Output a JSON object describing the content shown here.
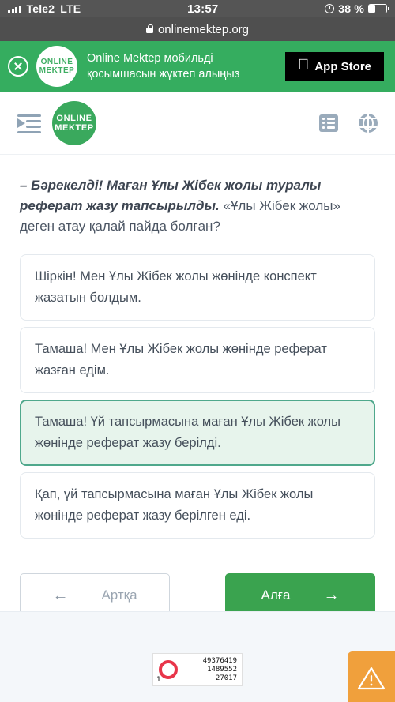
{
  "status_bar": {
    "carrier": "Tele2",
    "network": "LTE",
    "time": "13:57",
    "battery_percent": "38 %",
    "signal_icon": "signal-bars-icon",
    "alarm_icon": "alarm-clock-icon",
    "battery_icon": "battery-icon"
  },
  "browser": {
    "url": "onlinemektep.org",
    "lock_icon": "lock-icon"
  },
  "app_banner": {
    "close_icon": "close-icon",
    "logo_line1": "ONLINE",
    "logo_line2": "MEKTEP",
    "promo_line1": "Online Mektep мобильді",
    "promo_line2": "қосымшасын жүктеп алыңыз",
    "store_button_label": "App Store",
    "apple_icon": "apple-logo-icon",
    "background_color": "#35ad5f"
  },
  "toolbar": {
    "menu_icon": "menu-indent-icon",
    "logo_line1": "ONLINE",
    "logo_line2": "MEKTEP",
    "list_icon": "list-icon",
    "globe_icon": "globe-icon"
  },
  "main": {
    "question_bold": "– Бәрекелді! Маған Ұлы Жібек жолы туралы реферат жазу тапсырылды.",
    "question_rest": " «Ұлы Жібек жолы» деген атау қалай пайда болған?",
    "options": [
      {
        "text": "Шіркін! Мен Ұлы Жібек жолы жөнінде конспект жазатын болдым.",
        "selected": false
      },
      {
        "text": "Тамаша! Мен Ұлы Жібек жолы жөнінде реферат жазған едім.",
        "selected": false
      },
      {
        "text": "Тамаша! Үй тапсырмасына маған Ұлы Жібек жолы жөнінде реферат жазу берілді.",
        "selected": true
      },
      {
        "text": "Қап, үй тапсырмасына маған Ұлы Жібек жолы жөнінде реферат жазу берілген еді.",
        "selected": false
      }
    ],
    "selected_color": "#4fa88c",
    "selected_background": "#e7f4ec"
  },
  "navigation": {
    "back_label": "Артқа",
    "back_arrow_icon": "arrow-left-icon",
    "back_arrow": "←",
    "next_label": "Алға",
    "next_arrow_icon": "arrow-right-icon",
    "next_arrow": "→",
    "next_color": "#3aa34f"
  },
  "footer": {
    "counter": {
      "ring_icon": "red-ring-icon",
      "line1": "49376419",
      "line2": "1489552",
      "line3": "27017",
      "index": "1"
    },
    "report_button": {
      "icon": "warning-triangle-icon",
      "color": "#f0a03c"
    }
  }
}
